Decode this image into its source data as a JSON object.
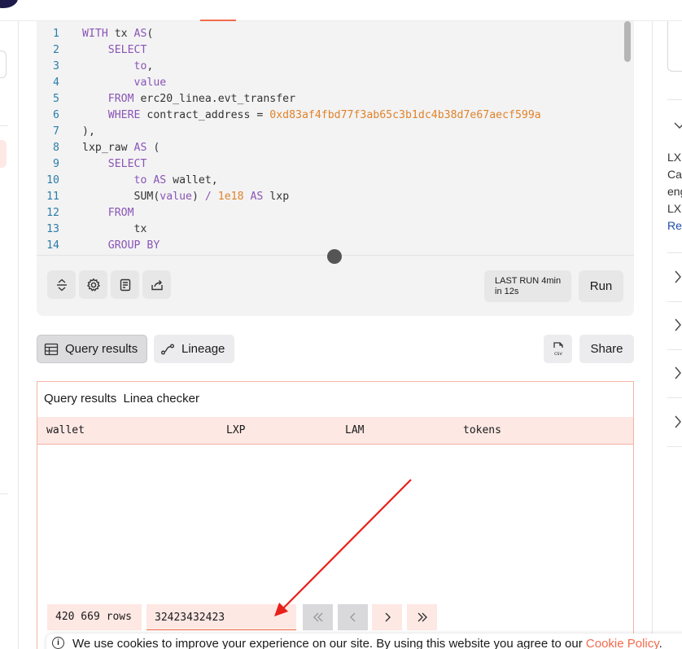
{
  "editor": {
    "lines": [
      {
        "n": "1",
        "segs": [
          {
            "t": "WITH ",
            "c": "kw"
          },
          {
            "t": "tx ",
            "c": ""
          },
          {
            "t": "AS",
            "c": "kw"
          },
          {
            "t": "(",
            "c": ""
          }
        ]
      },
      {
        "n": "2",
        "segs": [
          {
            "t": "    ",
            "c": ""
          },
          {
            "t": "SELECT",
            "c": "kw"
          }
        ]
      },
      {
        "n": "3",
        "segs": [
          {
            "t": "        ",
            "c": ""
          },
          {
            "t": "to",
            "c": "kw"
          },
          {
            "t": ",",
            "c": ""
          }
        ]
      },
      {
        "n": "4",
        "segs": [
          {
            "t": "        ",
            "c": ""
          },
          {
            "t": "value",
            "c": "kw"
          }
        ]
      },
      {
        "n": "5",
        "segs": [
          {
            "t": "    ",
            "c": ""
          },
          {
            "t": "FROM ",
            "c": "kw"
          },
          {
            "t": "erc20_linea.evt_transfer",
            "c": ""
          }
        ]
      },
      {
        "n": "6",
        "segs": [
          {
            "t": "    ",
            "c": ""
          },
          {
            "t": "WHERE ",
            "c": "kw"
          },
          {
            "t": "contract_address = ",
            "c": ""
          },
          {
            "t": "0xd83af4fbd77f3ab65c3b1dc4b38d7e67aecf599a",
            "c": "str"
          }
        ]
      },
      {
        "n": "7",
        "segs": [
          {
            "t": "),",
            "c": ""
          }
        ]
      },
      {
        "n": "8",
        "segs": [
          {
            "t": "lxp_raw ",
            "c": ""
          },
          {
            "t": "AS",
            "c": "kw"
          },
          {
            "t": " (",
            "c": ""
          }
        ]
      },
      {
        "n": "9",
        "segs": [
          {
            "t": "    ",
            "c": ""
          },
          {
            "t": "SELECT",
            "c": "kw"
          }
        ]
      },
      {
        "n": "10",
        "segs": [
          {
            "t": "        ",
            "c": ""
          },
          {
            "t": "to AS ",
            "c": "kw"
          },
          {
            "t": "wallet,",
            "c": ""
          }
        ]
      },
      {
        "n": "11",
        "segs": [
          {
            "t": "        ",
            "c": ""
          },
          {
            "t": "SUM(",
            "c": ""
          },
          {
            "t": "value",
            "c": "kw"
          },
          {
            "t": ") ",
            "c": ""
          },
          {
            "t": "/ ",
            "c": "op"
          },
          {
            "t": "1e18 ",
            "c": "str"
          },
          {
            "t": "AS ",
            "c": "kw"
          },
          {
            "t": "lxp",
            "c": ""
          }
        ]
      },
      {
        "n": "12",
        "segs": [
          {
            "t": "    ",
            "c": ""
          },
          {
            "t": "FROM",
            "c": "kw"
          }
        ]
      },
      {
        "n": "13",
        "segs": [
          {
            "t": "        ",
            "c": ""
          },
          {
            "t": "tx",
            "c": ""
          }
        ]
      },
      {
        "n": "14",
        "segs": [
          {
            "t": "    ",
            "c": ""
          },
          {
            "t": "GROUP BY",
            "c": "kw"
          }
        ]
      }
    ],
    "last_run_line1": "LAST RUN 4min",
    "last_run_line2": "in 12s",
    "run_label": "Run"
  },
  "tabs": {
    "query_results": "Query results",
    "lineage": "Lineage",
    "share": "Share",
    "csv_icon_label": "csv"
  },
  "results": {
    "title": "Query results",
    "subtitle": "Linea checker",
    "columns": [
      "wallet",
      "LXP",
      "LAM",
      "tokens"
    ],
    "rows_count": "420 669 rows",
    "page_input": "32423432423"
  },
  "right_panel": {
    "text_lines": [
      "LX",
      "Ca",
      "eng",
      "LX"
    ],
    "link": "Re"
  },
  "cookie": {
    "text": "We use cookies to improve your experience on our site. By using this website you agree to our ",
    "link": "Cookie Policy",
    "end": "."
  },
  "colors": {
    "accent": "#f26b4c",
    "keyword": "#8a55b5",
    "string": "#e0832a",
    "line_number": "#2c7ea8",
    "annotation_arrow": "#e8201a"
  }
}
